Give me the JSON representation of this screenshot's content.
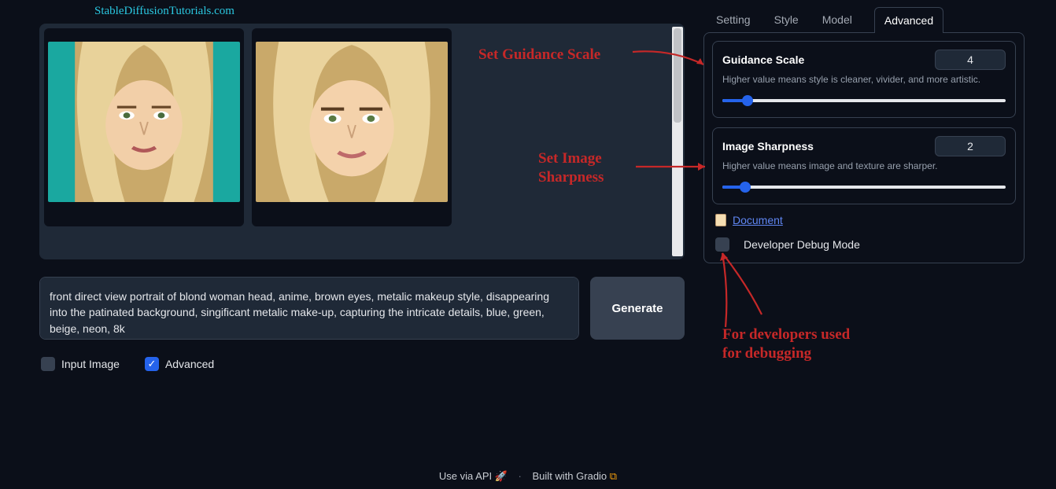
{
  "site_title": "StableDiffusionTutorials.com",
  "prompt_text": "front direct view portrait of blond woman head, anime, brown eyes, metalic makeup style, disappearing into the patinated background, singificant metalic make-up, capturing the intricate details, blue, green, beige, neon, 8k",
  "generate_label": "Generate",
  "checkboxes": {
    "input_image": {
      "label": "Input Image",
      "checked": false
    },
    "advanced": {
      "label": "Advanced",
      "checked": true
    }
  },
  "tabs": [
    "Setting",
    "Style",
    "Model",
    "Advanced"
  ],
  "active_tab": "Advanced",
  "guidance": {
    "title": "Guidance Scale",
    "value": "4",
    "help": "Higher value means style is cleaner, vivider, and more artistic.",
    "fill_pct": 9
  },
  "sharpness": {
    "title": "Image Sharpness",
    "value": "2",
    "help": "Higher value means image and texture are sharper.",
    "fill_pct": 8
  },
  "document_link": "Document",
  "debug_label": "Developer Debug Mode",
  "annotations": {
    "guidance": "Set Guidance Scale",
    "sharpness_l1": "Set Image",
    "sharpness_l2": "Sharpness",
    "debug_l1": "For developers used",
    "debug_l2": "for debugging"
  },
  "footer": {
    "api": "Use via API",
    "built": "Built with Gradio"
  }
}
